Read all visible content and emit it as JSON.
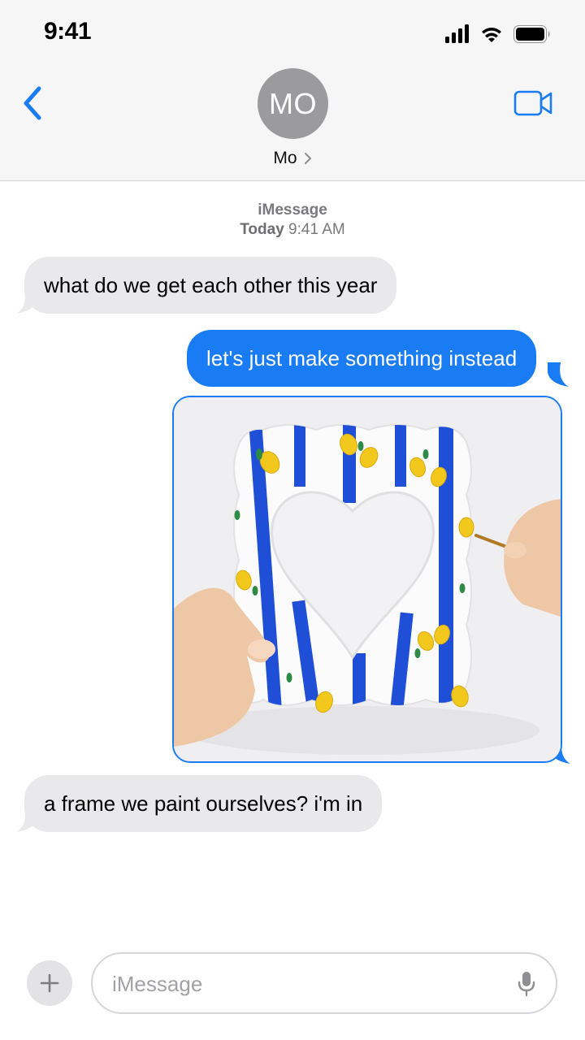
{
  "status_bar": {
    "time": "9:41",
    "icons": [
      "signal-icon",
      "wifi-icon",
      "battery-icon"
    ]
  },
  "header": {
    "avatar_initials": "MO",
    "contact_name": "Mo",
    "back_icon": "chevron-left-icon",
    "video_icon": "video-camera-icon"
  },
  "thread": {
    "service": "iMessage",
    "day": "Today",
    "time": "9:41 AM"
  },
  "messages": [
    {
      "direction": "incoming",
      "text": "what do we get each other this year"
    },
    {
      "direction": "outgoing",
      "text": "let's just make something instead"
    },
    {
      "direction": "outgoing",
      "type": "image"
    },
    {
      "direction": "incoming",
      "text": "a frame we paint ourselves? i'm in"
    }
  ],
  "composer": {
    "placeholder": "iMessage",
    "value": "",
    "plus_icon": "plus-icon",
    "mic_icon": "microphone-icon"
  },
  "colors": {
    "accent": "#1a7cf5",
    "incoming_bubble": "#e9e9eb",
    "header_bg": "#f6f6f6",
    "avatar_bg": "#9b9b9e"
  }
}
